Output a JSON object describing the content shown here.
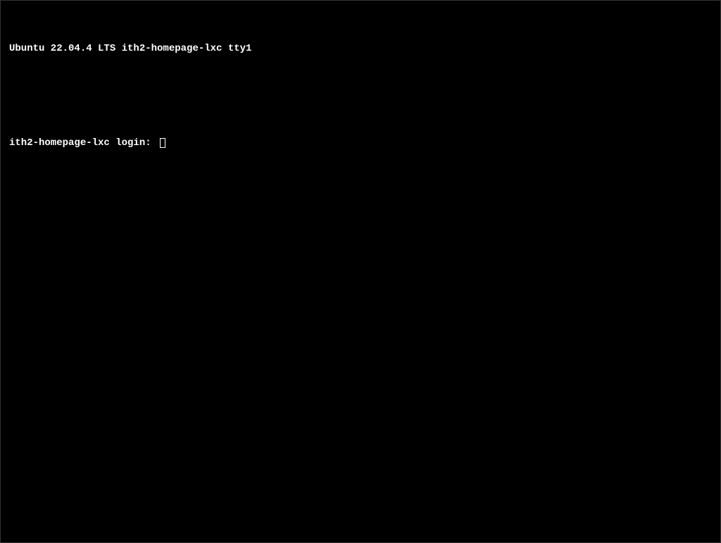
{
  "terminal": {
    "banner_line": "Ubuntu 22.04.4 LTS ith2-homepage-lxc tty1",
    "login_prompt": "ith2-homepage-lxc login: "
  }
}
